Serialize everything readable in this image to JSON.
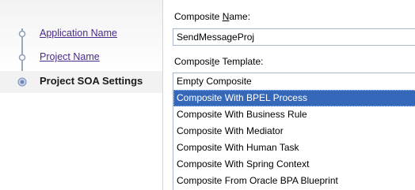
{
  "wizard": {
    "steps": [
      {
        "label": "Application Name",
        "state": "visited"
      },
      {
        "label": "Project Name",
        "state": "visited"
      },
      {
        "label": "Project SOA Settings",
        "state": "current"
      }
    ]
  },
  "form": {
    "composite_name": {
      "label_before": "Composite ",
      "label_mnemonic": "N",
      "label_after": "ame:",
      "value": "SendMessageProj"
    },
    "composite_template": {
      "label_before": "Composi",
      "label_mnemonic": "t",
      "label_after": "e Template:",
      "options": [
        "Empty Composite",
        "Composite With BPEL Process",
        "Composite With Business Rule",
        "Composite With Mediator",
        "Composite With Human Task",
        "Composite With Spring Context",
        "Composite From Oracle BPA Blueprint"
      ],
      "selected": "Composite With BPEL Process"
    }
  },
  "colors": {
    "selection": "#3568b8",
    "link": "#4a2a8a",
    "step_line": "#9aa8b8"
  }
}
